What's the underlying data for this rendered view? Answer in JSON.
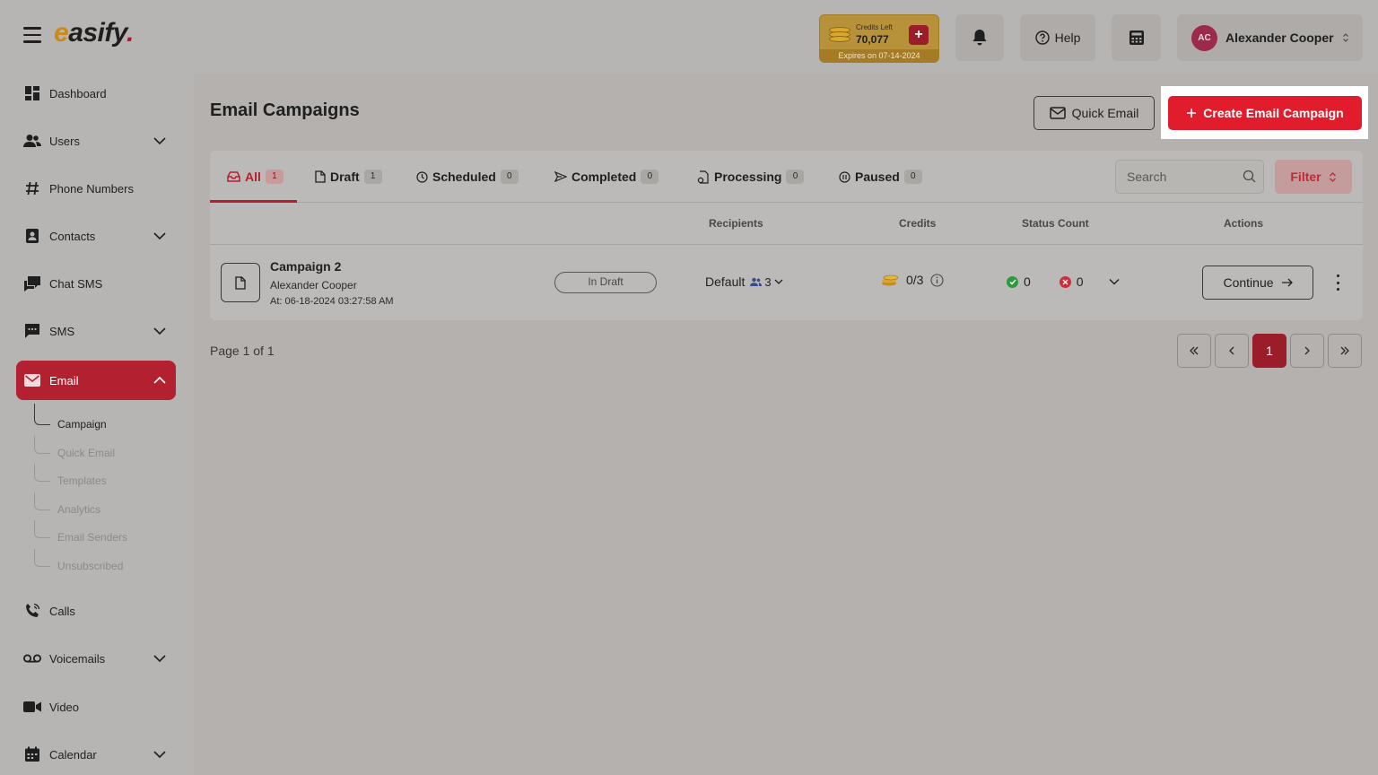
{
  "app": {
    "logo": "easify",
    "logo_first": "e",
    "logo_rest": "asify",
    "logo_dot": "."
  },
  "header": {
    "credits_label": "Credits Left",
    "credits_value": "70,077",
    "credits_expiry": "Expires on 07-14-2024",
    "help_label": "Help",
    "user_initials": "AC",
    "user_name": "Alexander Cooper"
  },
  "sidebar": {
    "items": [
      {
        "label": "Dashboard",
        "icon": "dashboard-icon"
      },
      {
        "label": "Users",
        "icon": "users-icon"
      },
      {
        "label": "Phone Numbers",
        "icon": "hash-icon"
      },
      {
        "label": "Contacts",
        "icon": "contacts-icon"
      },
      {
        "label": "Chat SMS",
        "icon": "chat-icon"
      },
      {
        "label": "SMS",
        "icon": "sms-icon"
      },
      {
        "label": "Email",
        "icon": "email-icon"
      },
      {
        "label": "Calls",
        "icon": "phone-icon"
      },
      {
        "label": "Voicemails",
        "icon": "voicemail-icon"
      },
      {
        "label": "Video",
        "icon": "video-icon"
      },
      {
        "label": "Calendar",
        "icon": "calendar-icon"
      }
    ],
    "email_sub": [
      "Campaign",
      "Quick Email",
      "Templates",
      "Analytics",
      "Email Senders",
      "Unsubscribed"
    ]
  },
  "main": {
    "title": "Email Campaigns",
    "quick_email_label": "Quick Email",
    "create_label": "Create Email Campaign",
    "tabs": [
      {
        "label": "All",
        "count": "1"
      },
      {
        "label": "Draft",
        "count": "1"
      },
      {
        "label": "Scheduled",
        "count": "0"
      },
      {
        "label": "Completed",
        "count": "0"
      },
      {
        "label": "Processing",
        "count": "0"
      },
      {
        "label": "Paused",
        "count": "0"
      }
    ],
    "search_placeholder": "Search",
    "filter_label": "Filter",
    "columns": {
      "recipients": "Recipients",
      "credits": "Credits",
      "status_count": "Status Count",
      "actions": "Actions"
    },
    "rows": [
      {
        "name": "Campaign 2",
        "owner": "Alexander Cooper",
        "at": "At: 06-18-2024 03:27:58 AM",
        "status": "In Draft",
        "recipients_group": "Default",
        "recipients_count": "3",
        "credits": "0/3",
        "success_count": "0",
        "failed_count": "0",
        "action_label": "Continue"
      }
    ],
    "page_info": "Page 1 of 1",
    "current_page": "1"
  },
  "colors": {
    "brand_red": "#e11d2d",
    "active_red": "#b3202f",
    "credits_gold": "#b7923a"
  }
}
